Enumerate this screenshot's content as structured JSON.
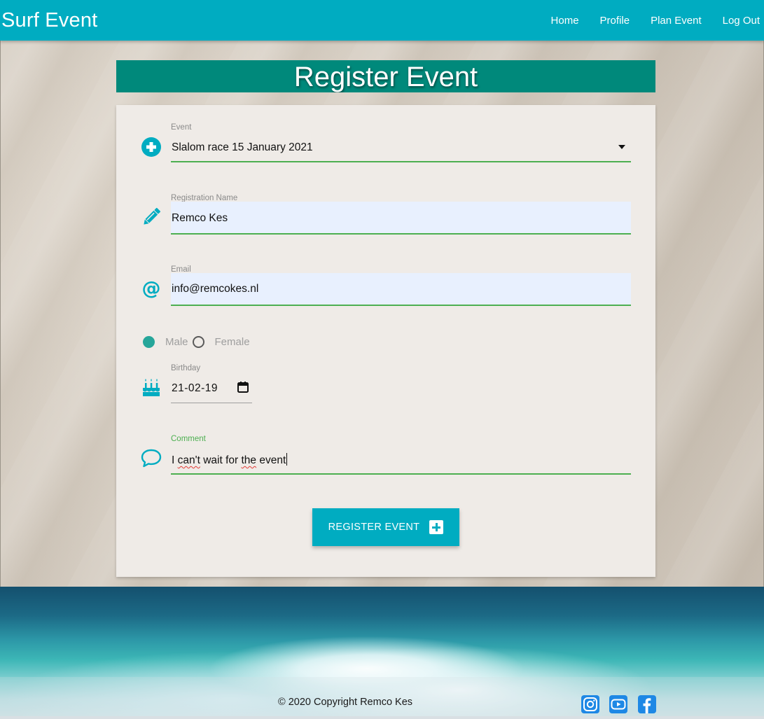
{
  "navbar": {
    "brand": "Surf Event",
    "links": [
      "Home",
      "Profile",
      "Plan Event",
      "Log Out"
    ]
  },
  "page": {
    "title": "Register Event"
  },
  "form": {
    "event": {
      "label": "Event",
      "value": "Slalom race 15  January 2021",
      "icon": "add-circle-icon"
    },
    "name": {
      "label": "Registration Name",
      "value": "Remco Kes",
      "icon": "pencil-icon"
    },
    "email": {
      "label": "Email",
      "value": "info@remcokes.nl",
      "icon": "at-icon"
    },
    "gender": {
      "options": [
        "Male",
        "Female"
      ],
      "selected": "Male"
    },
    "birthday": {
      "label": "Birthday",
      "value": "21-02-19",
      "icon": "birthday-cake-icon"
    },
    "comment": {
      "label": "Comment",
      "value_parts": [
        "I ",
        "can't",
        " wait for ",
        "the",
        " event"
      ],
      "icon": "speech-bubble-icon"
    },
    "submit_label": "REGISTER EVENT"
  },
  "footer": {
    "copyright": "© 2020 Copyright Remco Kes",
    "social": [
      "instagram-icon",
      "youtube-icon",
      "facebook-icon"
    ]
  },
  "colors": {
    "primary": "#00acc1",
    "banner": "#00897b",
    "valid_underline": "#4caf50",
    "radio_checked": "#26a69a"
  }
}
